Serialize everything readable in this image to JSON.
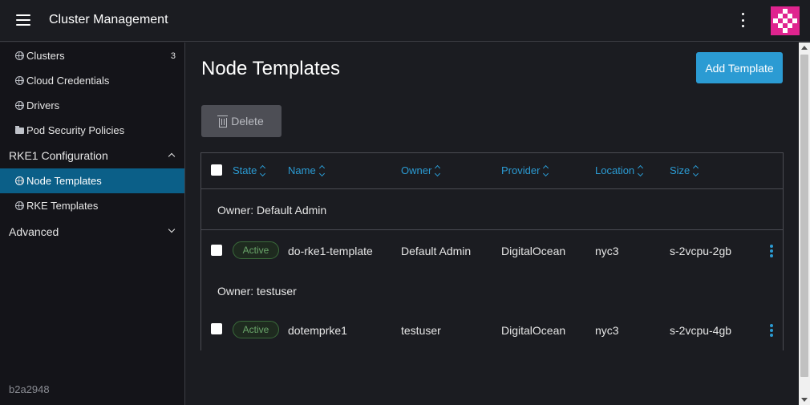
{
  "header": {
    "title": "Cluster Management",
    "menu_icon": "hamburger-icon",
    "more_icon": "kebab-icon",
    "logo_color": "#e0248f"
  },
  "sidebar": {
    "items": [
      {
        "label": "Clusters",
        "icon": "globe-icon",
        "count": "3"
      },
      {
        "label": "Cloud Credentials",
        "icon": "globe-icon"
      },
      {
        "label": "Drivers",
        "icon": "globe-icon"
      },
      {
        "label": "Pod Security Policies",
        "icon": "folder-icon"
      }
    ],
    "group_rke1": {
      "label": "RKE1 Configuration",
      "items": [
        {
          "label": "Node Templates",
          "icon": "globe-icon",
          "active": true
        },
        {
          "label": "RKE Templates",
          "icon": "globe-icon"
        }
      ]
    },
    "group_advanced": {
      "label": "Advanced"
    },
    "version": "b2a2948"
  },
  "main": {
    "title": "Node Templates",
    "add_button": "Add Template",
    "delete_button": "Delete",
    "accent_color": "#2b9bd3",
    "table": {
      "columns": [
        "State",
        "Name",
        "Owner",
        "Provider",
        "Location",
        "Size"
      ],
      "groups": [
        {
          "label": "Owner: Default Admin",
          "rows": [
            {
              "state": "Active",
              "name": "do-rke1-template",
              "owner": "Default Admin",
              "provider": "DigitalOcean",
              "location": "nyc3",
              "size": "s-2vcpu-2gb"
            }
          ]
        },
        {
          "label": "Owner: testuser",
          "rows": [
            {
              "state": "Active",
              "name": "dotemprke1",
              "owner": "testuser",
              "provider": "DigitalOcean",
              "location": "nyc3",
              "size": "s-2vcpu-4gb"
            }
          ]
        }
      ]
    }
  }
}
